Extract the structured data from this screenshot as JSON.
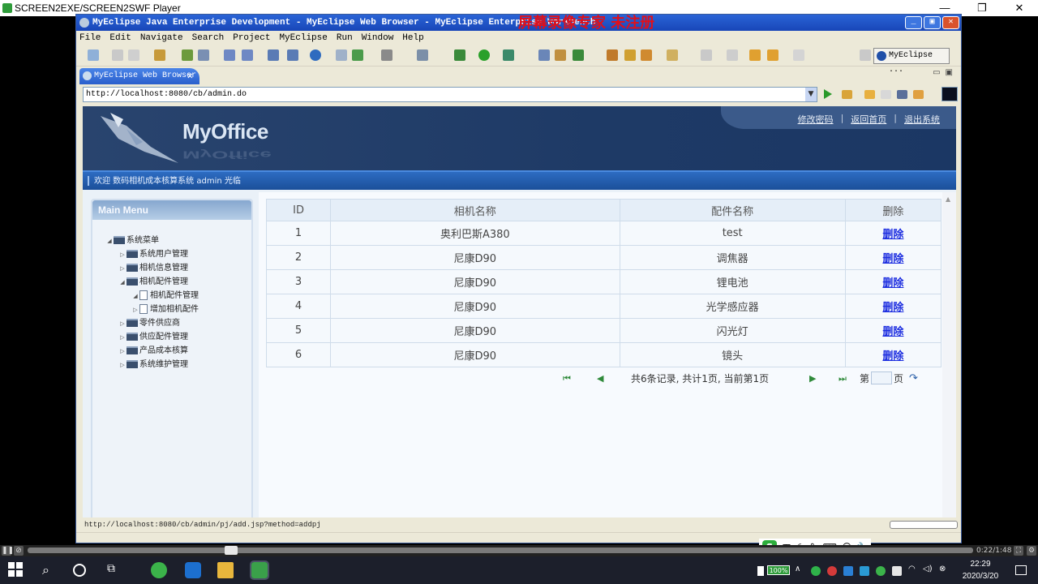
{
  "player": {
    "title": "SCREEN2EXE/SCREEN2SWF Player",
    "time": "0:22/1:48"
  },
  "eclipse": {
    "title": "MyEclipse Java Enterprise Development - MyEclipse Web Browser - MyEclipse Enterprise Workbench",
    "watermark": "屏幕录像专家 未注册",
    "menu": [
      "File",
      "Edit",
      "Navigate",
      "Search",
      "Project",
      "MyEclipse",
      "Run",
      "Window",
      "Help"
    ],
    "perspective": "MyEclipse ...",
    "tab_label": "MyEclipse Web Browser",
    "url": "http://localhost:8080/cb/admin.do",
    "status_url": "http://localhost:8080/cb/admin/pj/add.jsp?method=addpj"
  },
  "page": {
    "brand": "MyOffice",
    "links": [
      "修改密码",
      "返回首页",
      "退出系统"
    ],
    "welcome": "欢迎 数码相机成本核算系统 admin 光临",
    "sidebar_title": "Main Menu",
    "tree": [
      {
        "label": "系统菜单",
        "level": 1,
        "expanded": true
      },
      {
        "label": "系统用户管理",
        "level": 2,
        "expanded": false
      },
      {
        "label": "相机信息管理",
        "level": 2,
        "expanded": false
      },
      {
        "label": "相机配件管理",
        "level": 2,
        "expanded": true
      },
      {
        "label": "相机配件管理",
        "level": 3,
        "expanded": true
      },
      {
        "label": "增加相机配件",
        "level": 3,
        "expanded": false
      },
      {
        "label": "零件供应商",
        "level": 2,
        "expanded": false
      },
      {
        "label": "供应配件管理",
        "level": 2,
        "expanded": false
      },
      {
        "label": "产品成本核算",
        "level": 2,
        "expanded": false
      },
      {
        "label": "系统维护管理",
        "level": 2,
        "expanded": false
      }
    ],
    "table": {
      "headers": [
        "ID",
        "相机名称",
        "配件名称",
        "删除"
      ],
      "rows": [
        [
          "1",
          "奥利巴斯A380",
          "test",
          "删除"
        ],
        [
          "2",
          "尼康D90",
          "调焦器",
          "删除"
        ],
        [
          "3",
          "尼康D90",
          "锂电池",
          "删除"
        ],
        [
          "4",
          "尼康D90",
          "光学感应器",
          "删除"
        ],
        [
          "5",
          "尼康D90",
          "闪光灯",
          "删除"
        ],
        [
          "6",
          "尼康D90",
          "镜头",
          "删除"
        ]
      ]
    },
    "pager": {
      "summary": "共6条记录, 共计1页, 当前第1页",
      "page_label": "第",
      "page_unit": "页"
    }
  },
  "ime": {
    "label": "五"
  },
  "taskbar": {
    "clock_time": "22:29",
    "clock_date": "2020/3/20",
    "battery": "100%"
  }
}
